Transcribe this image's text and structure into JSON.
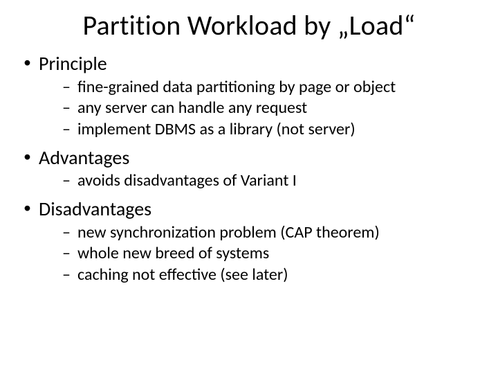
{
  "title": "Partition Workload by „Load“",
  "sections": [
    {
      "heading": "Principle",
      "items": [
        "fine-grained data partitioning by page or object",
        "any server can handle any request",
        "implement DBMS as a library (not server)"
      ]
    },
    {
      "heading": "Advantages",
      "items": [
        "avoids disadvantages of Variant I"
      ]
    },
    {
      "heading": "Disadvantages",
      "items": [
        "new synchronization problem (CAP theorem)",
        "whole new breed of systems",
        "caching not effective (see later)"
      ]
    }
  ]
}
